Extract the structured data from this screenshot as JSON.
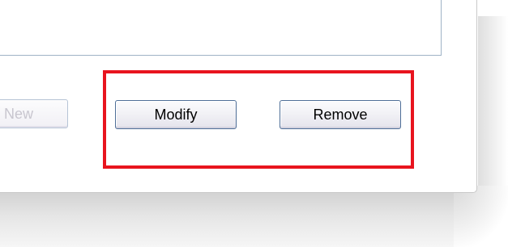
{
  "dialog": {
    "buttons": {
      "new_label": "New",
      "modify_label": "Modify",
      "remove_label": "Remove"
    }
  },
  "colors": {
    "highlight": "#e8141e",
    "button_border": "#4f6f98",
    "list_border": "#9fb3c6"
  }
}
